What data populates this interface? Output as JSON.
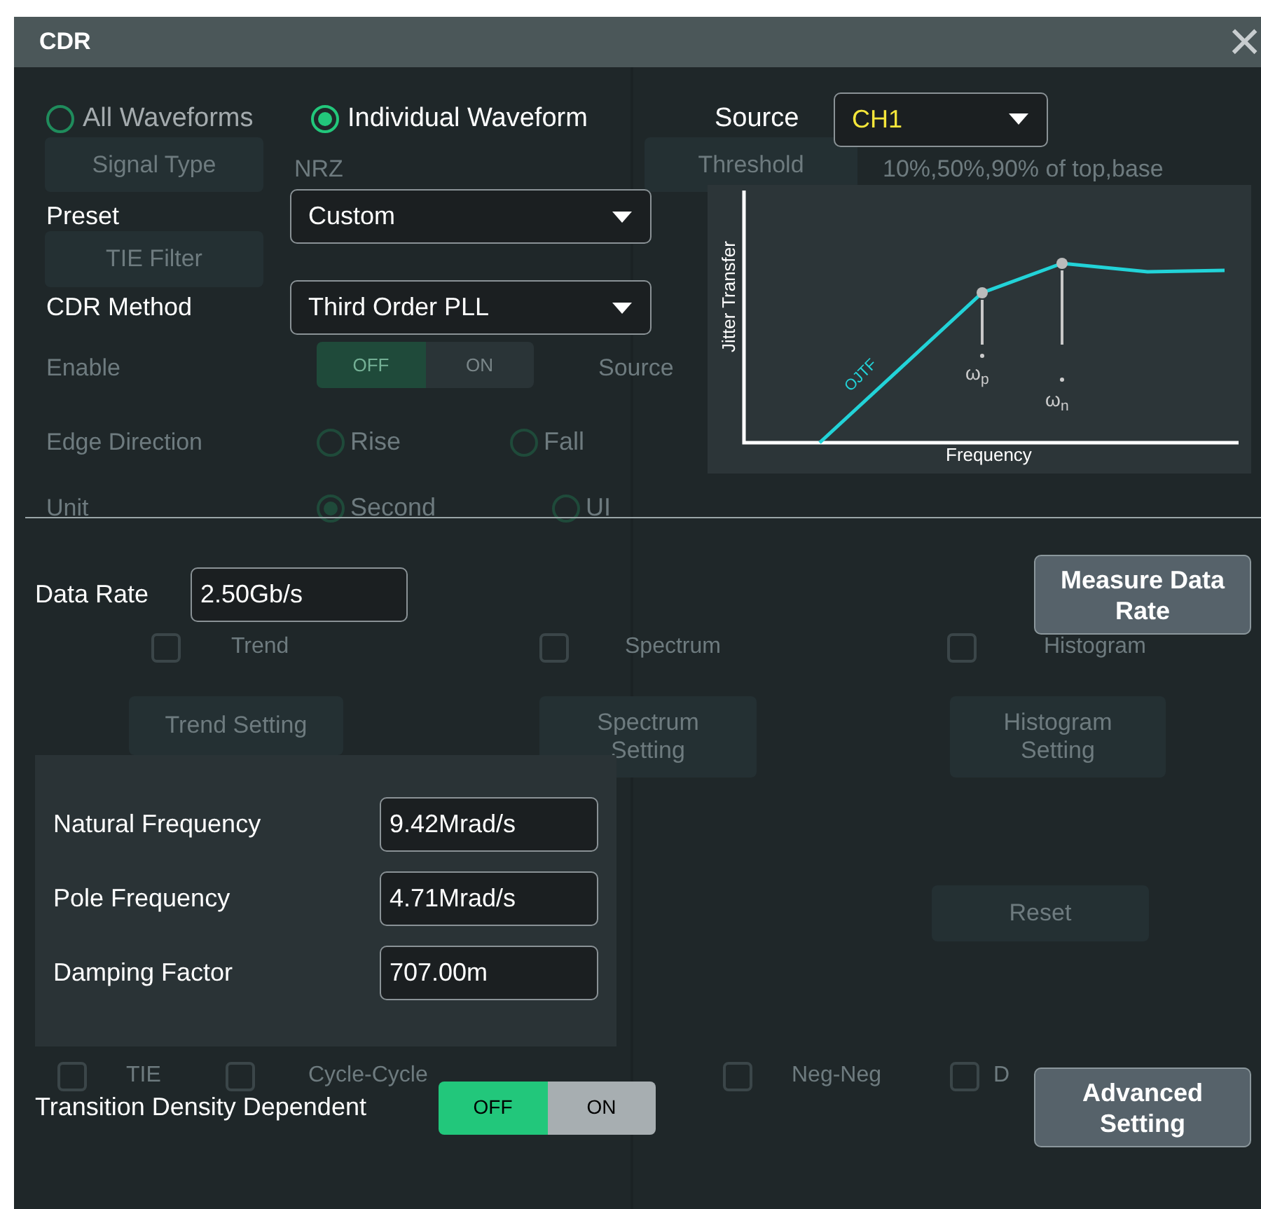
{
  "background": [
    {
      "kind": "button",
      "label": "Signal Type"
    },
    {
      "kind": "text",
      "label": "NRZ"
    },
    {
      "kind": "button",
      "label": "Threshold"
    },
    {
      "kind": "text",
      "label": "10%,50%,90% of top,base"
    },
    {
      "kind": "button",
      "label": "TIE Filter"
    },
    {
      "kind": "text",
      "label": "Enable"
    },
    {
      "kind": "toggle",
      "off": "OFF",
      "on": "ON",
      "on_state": false
    },
    {
      "kind": "text",
      "label": "Source"
    },
    {
      "kind": "text",
      "label": "Edge Direction"
    },
    {
      "kind": "radio",
      "label": "Rise",
      "selected": false
    },
    {
      "kind": "radio",
      "label": "Fall",
      "selected": false
    },
    {
      "kind": "text",
      "label": "Unit"
    },
    {
      "kind": "radio",
      "label": "Second",
      "selected": true
    },
    {
      "kind": "radio",
      "label": "UI",
      "selected": false
    },
    {
      "kind": "checkbox",
      "label": "Trend",
      "checked": false
    },
    {
      "kind": "checkbox",
      "label": "Spectrum",
      "checked": false
    },
    {
      "kind": "checkbox",
      "label": "Histogram",
      "checked": false
    },
    {
      "kind": "button",
      "label": "Trend Setting"
    },
    {
      "kind": "button",
      "label": "Spectrum Setting"
    },
    {
      "kind": "button",
      "label": "Histogram Setting"
    },
    {
      "kind": "button",
      "label": "Reset"
    },
    {
      "kind": "checkbox",
      "label": "TIE",
      "checked": false
    },
    {
      "kind": "checkbox",
      "label": "Cycle-Cycle",
      "checked": false
    },
    {
      "kind": "checkbox",
      "label": "Neg-Neg",
      "checked": false
    },
    {
      "kind": "checkbox",
      "label": "D",
      "checked": false
    }
  ],
  "dialog": {
    "title": "CDR",
    "close": "×",
    "scope": [
      {
        "label": "All Waveforms",
        "selected": false
      },
      {
        "label": "Individual Waveform",
        "selected": true
      }
    ],
    "source": {
      "label": "Source",
      "value": "CH1"
    },
    "preset": {
      "label": "Preset",
      "value": "Custom"
    },
    "cdr_method": {
      "label": "CDR Method",
      "value": "Third Order PLL"
    },
    "diagram": {
      "ylabel": "Jitter Transfer",
      "xlabel": "Frequency",
      "curve": "OJTF",
      "wp": "ω$_{p}$",
      "wn": "ω$_{n}$"
    },
    "data_rate": {
      "label": "Data Rate",
      "value": "2.50Gb/s"
    },
    "measure_button": "Measure Data Rate",
    "params": [
      {
        "label": "Natural Frequency",
        "value": "9.42Mrad/s"
      },
      {
        "label": "Pole Frequency",
        "value": "4.71Mrad/s"
      },
      {
        "label": "Damping Factor",
        "value": "707.00m"
      }
    ],
    "transition": {
      "label": "Transition Density Dependent",
      "off": "OFF",
      "on": "ON",
      "on_state": false
    },
    "advanced_button": "Advanced Setting"
  }
}
